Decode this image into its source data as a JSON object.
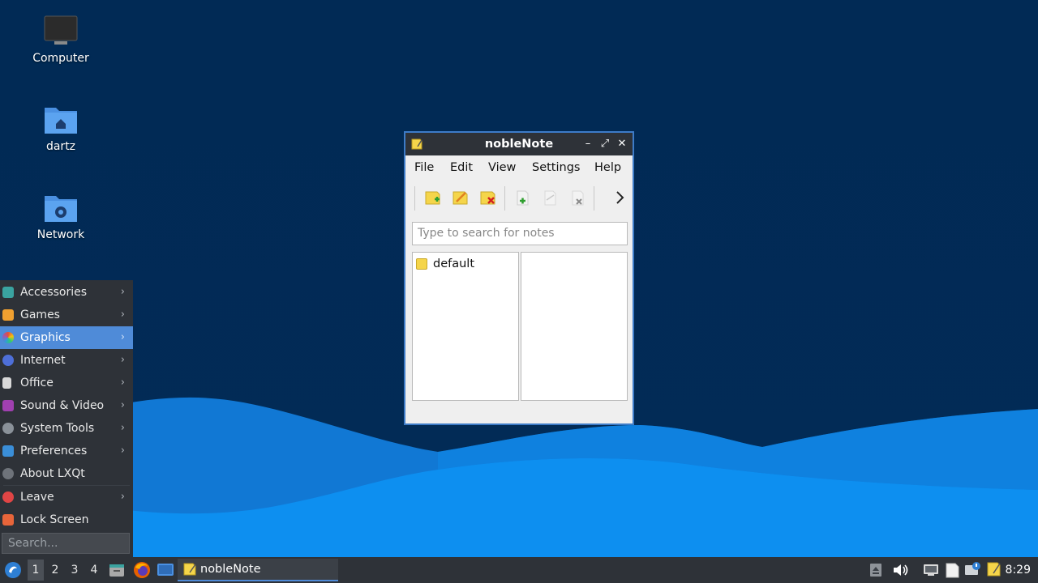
{
  "desktop": {
    "icons": [
      {
        "label": "Computer",
        "icon": "computer-icon"
      },
      {
        "label": "dartz",
        "icon": "home-folder-icon"
      },
      {
        "label": "Network",
        "icon": "network-folder-icon"
      }
    ]
  },
  "app_menu": {
    "items": [
      {
        "label": "Accessories",
        "icon": "accessories-icon",
        "has_submenu": true
      },
      {
        "label": "Games",
        "icon": "games-icon",
        "has_submenu": true
      },
      {
        "label": "Graphics",
        "icon": "graphics-icon",
        "has_submenu": true,
        "active": true
      },
      {
        "label": "Internet",
        "icon": "internet-icon",
        "has_submenu": true
      },
      {
        "label": "Office",
        "icon": "office-icon",
        "has_submenu": true
      },
      {
        "label": "Sound & Video",
        "icon": "sound-video-icon",
        "has_submenu": true
      },
      {
        "label": "System Tools",
        "icon": "system-tools-icon",
        "has_submenu": true
      },
      {
        "label": "Preferences",
        "icon": "preferences-icon",
        "has_submenu": true
      },
      {
        "label": "About LXQt",
        "icon": "about-icon",
        "has_submenu": false
      },
      {
        "label": "Leave",
        "icon": "leave-icon",
        "has_submenu": true
      },
      {
        "label": "Lock Screen",
        "icon": "lock-icon",
        "has_submenu": false
      }
    ],
    "search_placeholder": "Search..."
  },
  "window": {
    "title": "nobleNote",
    "menubar": [
      "File",
      "Edit",
      "View",
      "Settings",
      "Help"
    ],
    "toolbar": [
      "new-folder-icon",
      "rename-folder-icon",
      "delete-folder-icon",
      "new-note-icon",
      "rename-note-icon",
      "delete-note-icon",
      "more-chevron-icon"
    ],
    "search_placeholder": "Type to search for notes",
    "folders": [
      "default"
    ]
  },
  "taskbar": {
    "desktops": [
      "1",
      "2",
      "3",
      "4"
    ],
    "active_desktop": "1",
    "task_label": "nobleNote",
    "clock": "8:29"
  },
  "colors": {
    "accent": "#4f8bd8",
    "panel": "#2e3238",
    "desktop_bg": "#022a52"
  }
}
